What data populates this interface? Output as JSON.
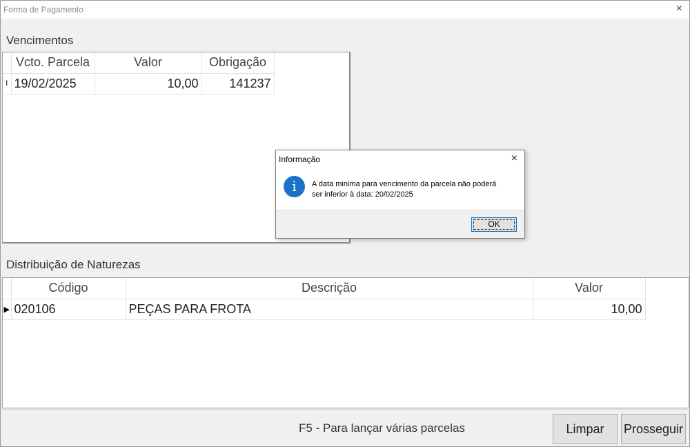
{
  "window": {
    "title": "Forma de Pagamento",
    "close_icon": "×"
  },
  "vencimentos": {
    "label": "Vencimentos",
    "columns": [
      "Vcto. Parcela",
      "Valor",
      "Obrigação"
    ],
    "rows": [
      {
        "indicator": "I",
        "vcto": "19/02/2025",
        "valor": "10,00",
        "obrigacao": "141237"
      }
    ]
  },
  "distribuicao": {
    "label": "Distribuição de Naturezas",
    "columns": [
      "Código",
      "Descrição",
      "Valor"
    ],
    "rows": [
      {
        "indicator": "▶",
        "codigo": "020106",
        "descricao": "PEÇAS PARA FROTA",
        "valor": "10,00"
      }
    ]
  },
  "footer": {
    "hint": "F5 - Para lançar várias parcelas",
    "limpar_label": "Limpar",
    "prosseguir_label": "Prosseguir"
  },
  "dialog": {
    "title": "Informação",
    "close_icon": "×",
    "icon": "info-icon",
    "icon_glyph": "i",
    "message_line1": "A data minima para vencimento da parcela não poderá",
    "message_line2": "ser inferior à data: 20/02/2025",
    "ok_label": "OK"
  }
}
